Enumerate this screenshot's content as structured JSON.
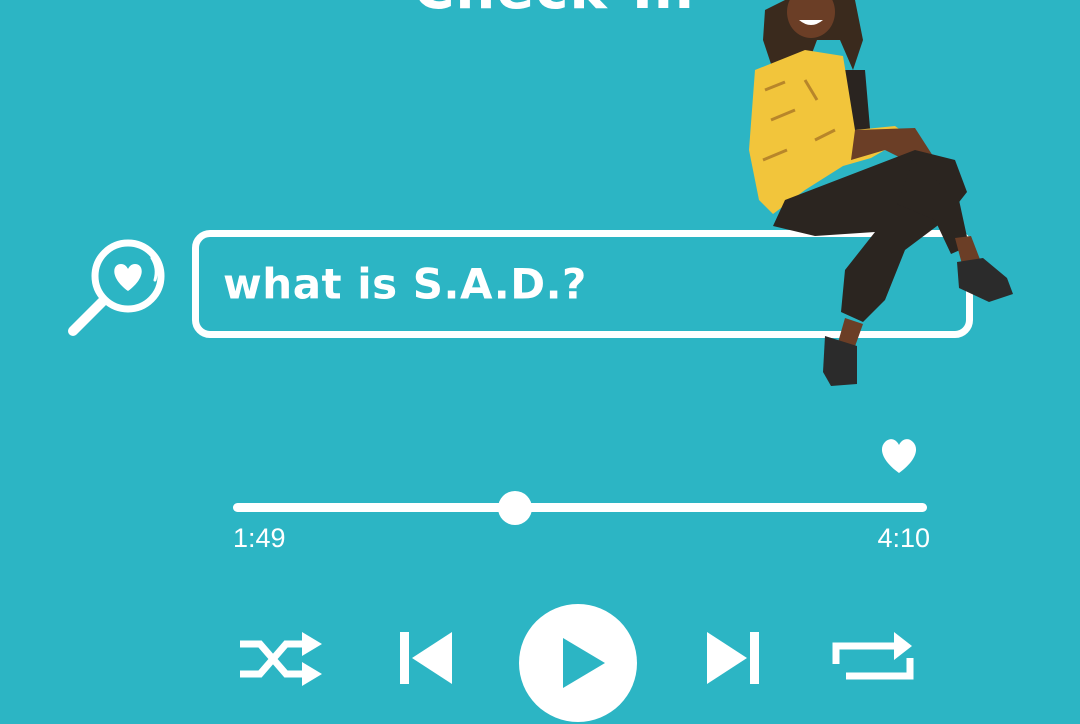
{
  "header": {
    "title": "Check-In"
  },
  "search": {
    "query": "what is S.A.D.?",
    "icon": "heart-magnifier-icon"
  },
  "player": {
    "elapsed": "1:49",
    "total": "4:10",
    "progress_fraction": 0.406,
    "like_icon": "heart-icon",
    "controls": [
      "shuffle-icon",
      "previous-icon",
      "play-icon",
      "next-icon",
      "repeat-icon"
    ]
  },
  "colors": {
    "background": "#2cb5c4",
    "foreground": "#ffffff",
    "accent": "#2cb5c4"
  }
}
